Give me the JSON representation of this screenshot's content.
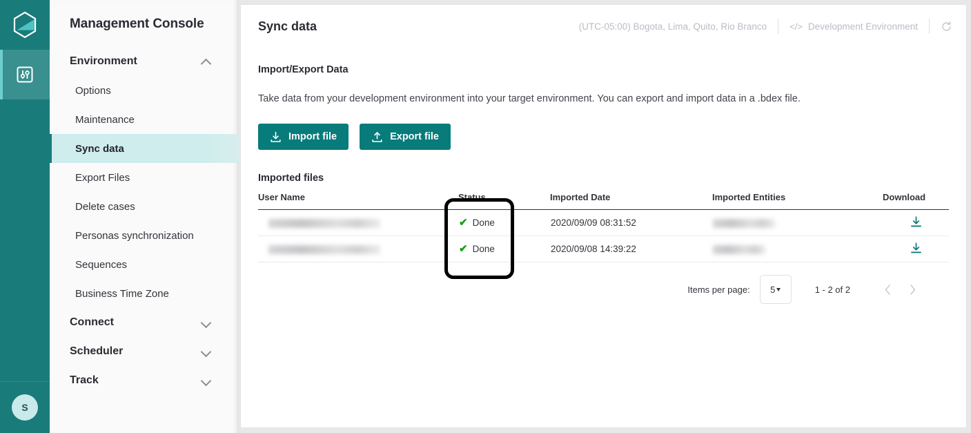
{
  "rail": {
    "logo_icon": "hexagon-logo-icon",
    "items": [
      {
        "icon": "sliders-settings-icon",
        "active": true
      }
    ],
    "avatar_initial": "S"
  },
  "sidebar": {
    "title": "Management Console",
    "groups": [
      {
        "label": "Environment",
        "expanded": true,
        "chevron": "chevron-up-icon",
        "items": [
          {
            "label": "Options",
            "active": false
          },
          {
            "label": "Maintenance",
            "active": false
          },
          {
            "label": "Sync data",
            "active": true
          },
          {
            "label": "Export Files",
            "active": false
          },
          {
            "label": "Delete cases",
            "active": false
          },
          {
            "label": "Personas synchronization",
            "active": false
          },
          {
            "label": "Sequences",
            "active": false
          },
          {
            "label": "Business Time Zone",
            "active": false
          }
        ]
      },
      {
        "label": "Connect",
        "expanded": false,
        "chevron": "chevron-down-icon",
        "items": []
      },
      {
        "label": "Scheduler",
        "expanded": false,
        "chevron": "chevron-down-icon",
        "items": []
      },
      {
        "label": "Track",
        "expanded": false,
        "chevron": "chevron-down-icon",
        "items": []
      }
    ]
  },
  "topbar": {
    "page_title": "Sync data",
    "timezone": "(UTC-05:00) Bogota, Lima, Quito, Rio Branco",
    "code_icon": "</>",
    "environment": "Development Environment",
    "refresh_icon": "refresh-icon"
  },
  "main": {
    "section_title": "Import/Export Data",
    "description": "Take data from your development environment into your target environment. You can export and import data in a .bdex file.",
    "import_button": "Import file",
    "export_button": "Export file",
    "import_icon": "download-file-icon",
    "export_icon": "upload-file-icon",
    "table_title": "Imported files",
    "columns": [
      "User Name",
      "Status",
      "Imported Date",
      "Imported Entities",
      "Download"
    ],
    "rows": [
      {
        "user_name": "",
        "status": "Done",
        "status_icon": "check-icon",
        "imported_date": "2020/09/09 08:31:52",
        "imported_entities": "",
        "download_icon": "download-icon"
      },
      {
        "user_name": "",
        "status": "Done",
        "status_icon": "check-icon",
        "imported_date": "2020/09/08 14:39:22",
        "imported_entities": "",
        "download_icon": "download-icon"
      }
    ],
    "pagination": {
      "items_per_page_label": "Items per page:",
      "items_per_page_value": "5",
      "range": "1 - 2 of 2",
      "prev_icon": "chevron-left-icon",
      "next_icon": "chevron-right-icon"
    },
    "annotation": {
      "target": "Status column highlight",
      "color": "#000000"
    }
  },
  "colors": {
    "rail_bg": "#1a7b7b",
    "rail_active": "#3a8f8f",
    "accent": "#087b7b",
    "active_nav_bg": "#cfeded",
    "check_green": "#14a014",
    "avatar_bg": "#c9eaea"
  }
}
